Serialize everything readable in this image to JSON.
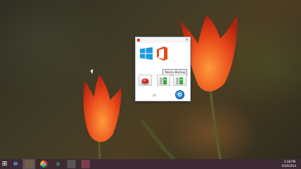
{
  "dialog": {
    "title": "",
    "close_glyph": "×",
    "tooltip": "Tokens Backup",
    "ok_label": "Ok",
    "buttons": [
      {
        "name": "activate",
        "icon": "red-button-icon"
      },
      {
        "name": "backup",
        "icon": "green-slider-icon"
      },
      {
        "name": "restore",
        "icon": "green-slider-icon"
      }
    ],
    "colors": {
      "windows": "#1e9be0",
      "office": "#e3491d",
      "accent": "#1d72c8"
    }
  },
  "taskbar": {
    "start_glyph": "⊞",
    "items": [
      {
        "name": "internet-explorer",
        "icon": "ie-icon",
        "glyph": "e"
      },
      {
        "name": "file-explorer",
        "icon": "folder-icon",
        "glyph": ""
      },
      {
        "name": "chrome",
        "icon": "chrome-icon",
        "glyph": ""
      },
      {
        "name": "camtasia",
        "icon": "camtasia-icon",
        "glyph": "a"
      },
      {
        "name": "app5",
        "icon": "app-icon",
        "glyph": ""
      },
      {
        "name": "app6",
        "icon": "app-icon",
        "glyph": ""
      }
    ],
    "clock": {
      "time": "2:38 PM",
      "date": "6/30/2014"
    }
  }
}
